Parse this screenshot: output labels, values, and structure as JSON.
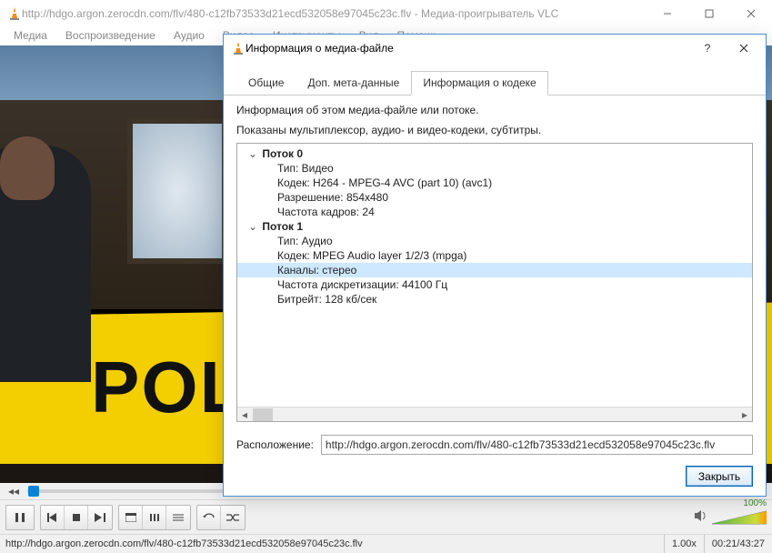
{
  "window": {
    "title": "http://hdgo.argon.zerocdn.com/flv/480-c12fb73533d21ecd532058e97045c23c.flv - Медиа-проигрыватель VLC"
  },
  "menu": {
    "items": [
      "Медиа",
      "Воспроизведение",
      "Аудио",
      "Видео",
      "Инструменты",
      "Вид",
      "Помощь"
    ]
  },
  "video": {
    "tape_text": "POLIC"
  },
  "controls": {
    "volume_label": "100%"
  },
  "status": {
    "path": "http://hdgo.argon.zerocdn.com/flv/480-c12fb73533d21ecd532058e97045c23c.flv",
    "speed": "1.00x",
    "time": "00:21/43:27"
  },
  "dialog": {
    "title": "Информация о медиа-файле",
    "tabs": [
      "Общие",
      "Доп. мета-данные",
      "Информация о кодеке"
    ],
    "active_tab": 2,
    "info_line1": "Информация об этом медиа-файле или потоке.",
    "info_line2": "Показаны мультиплексор, аудио- и видео-кодеки, субтитры.",
    "streams": [
      {
        "name": "Поток 0",
        "props": [
          "Тип: Видео",
          "Кодек: H264 - MPEG-4 AVC (part 10) (avc1)",
          "Разрешение: 854x480",
          "Частота кадров: 24"
        ]
      },
      {
        "name": "Поток 1",
        "props": [
          "Тип: Аудио",
          "Кодек: MPEG Audio layer 1/2/3 (mpga)",
          "Каналы: стерео",
          "Частота дискретизации: 44100 Гц",
          "Битрейт: 128 кб/сек"
        ]
      }
    ],
    "selected": {
      "stream": 1,
      "prop": 2
    },
    "location_label": "Расположение:",
    "location_value": "http://hdgo.argon.zerocdn.com/flv/480-c12fb73533d21ecd532058e97045c23c.flv",
    "close_label": "Закрыть"
  }
}
